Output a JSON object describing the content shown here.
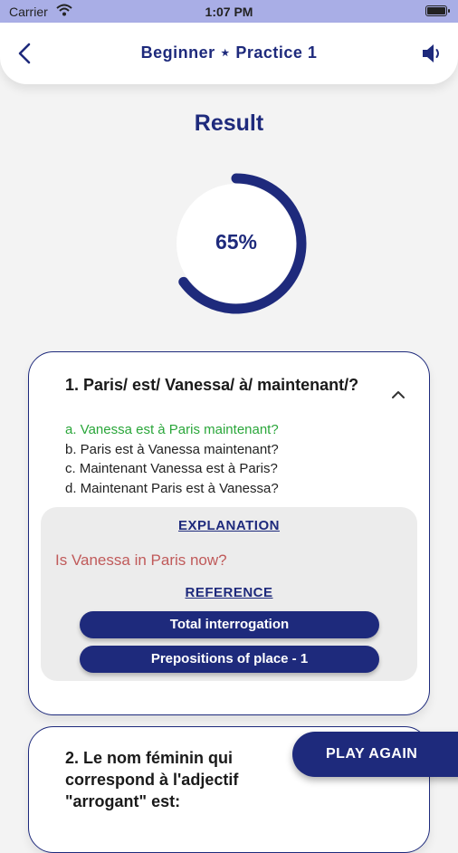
{
  "status_bar": {
    "carrier": "Carrier",
    "time": "1:07 PM"
  },
  "header": {
    "title": "Beginner ⋆ Practice 1",
    "back_icon": "chevron-left-icon",
    "sound_icon": "speaker-icon"
  },
  "result": {
    "title": "Result",
    "percent_label": "65%",
    "progress": 0.65
  },
  "questions": [
    {
      "text": "1. Paris/ est/ Vanessa/ à/ maintenant/?",
      "options": [
        "a. Vanessa est à Paris maintenant?",
        "b. Paris est à Vanessa maintenant?",
        "c. Maintenant Vanessa est à Paris?",
        "d. Maintenant Paris est à Vanessa?"
      ],
      "correct_index": 0,
      "explanation_heading": "EXPLANATION",
      "explanation_text": "Is Vanessa in Paris now?",
      "reference_heading": "REFERENCE",
      "references": [
        "Total interrogation",
        "Prepositions of place - 1"
      ]
    },
    {
      "text": "2. Le nom féminin qui correspond à l'adjectif \"arrogant\" est:"
    }
  ],
  "play_again_label": "PLAY AGAIN",
  "colors": {
    "primary": "#1e2a7c",
    "correct": "#2aa63a",
    "explanation": "#c05a5a",
    "status_bar": "#a9aee6"
  }
}
